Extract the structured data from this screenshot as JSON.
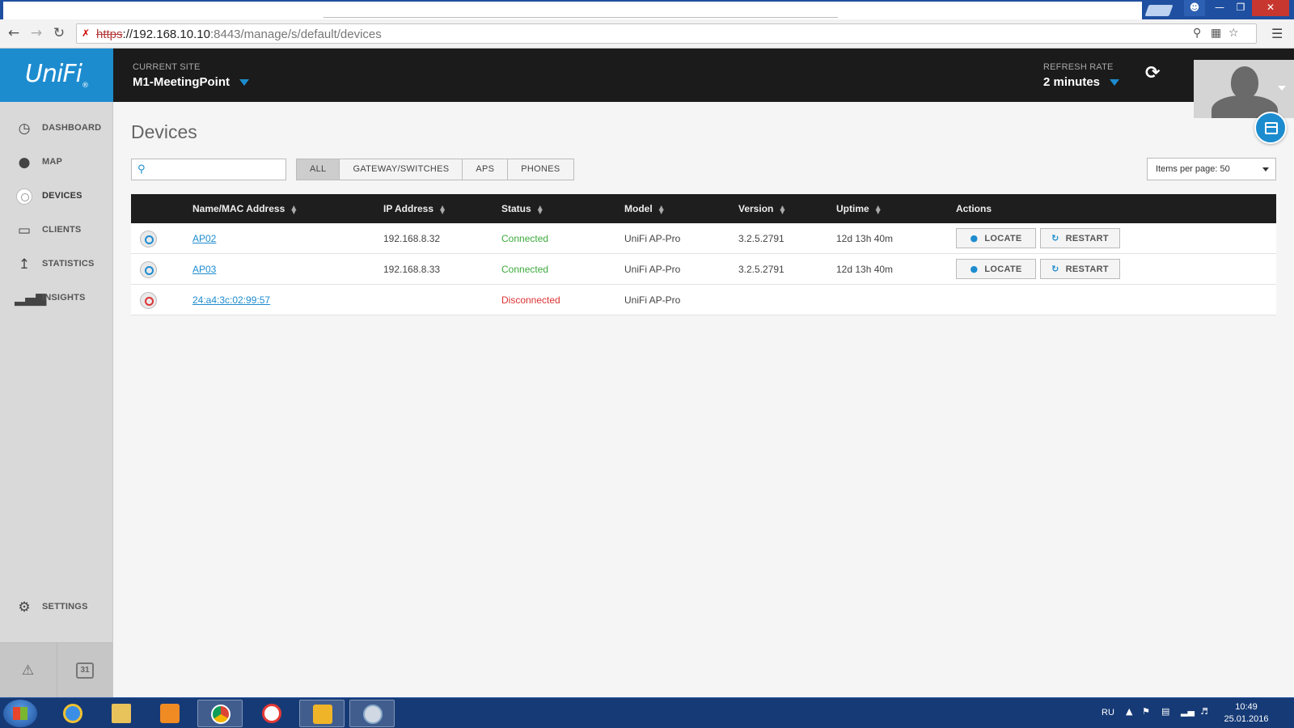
{
  "browser": {
    "url_protocol": "https",
    "url_host": "://192.168.10.10",
    "url_rest": ":8443/manage/s/default/devices"
  },
  "sidebar": {
    "logo": "UniFi",
    "items": [
      {
        "label": "DASHBOARD",
        "icon": "dashboard-gauge-icon"
      },
      {
        "label": "MAP",
        "icon": "map-pin-icon"
      },
      {
        "label": "DEVICES",
        "icon": "devices-icon"
      },
      {
        "label": "CLIENTS",
        "icon": "laptop-icon"
      },
      {
        "label": "STATISTICS",
        "icon": "line-chart-icon"
      },
      {
        "label": "INSIGHTS",
        "icon": "bar-chart-icon"
      }
    ],
    "settings": "SETTINGS",
    "calendar_day": "31"
  },
  "header": {
    "site_caption": "CURRENT SITE",
    "site_name": "M1-MeetingPoint",
    "rate_caption": "REFRESH RATE",
    "rate_value": "2 minutes"
  },
  "main": {
    "title": "Devices",
    "search_placeholder": "",
    "filters": [
      "ALL",
      "GATEWAY/SWITCHES",
      "APS",
      "PHONES"
    ],
    "selected_filter": "ALL",
    "per_page": "Items per page: 50"
  },
  "table": {
    "columns": [
      "Name/MAC Address",
      "IP Address",
      "Status",
      "Model",
      "Version",
      "Uptime",
      "Actions"
    ],
    "locate_label": "LOCATE",
    "restart_label": "RESTART",
    "rows": [
      {
        "name": "AP02",
        "ip": "192.168.8.32",
        "status": "Connected",
        "model": "UniFi AP-Pro",
        "version": "3.2.5.2791",
        "uptime": "12d 13h 40m"
      },
      {
        "name": "AP03",
        "ip": "192.168.8.33",
        "status": "Connected",
        "model": "UniFi AP-Pro",
        "version": "3.2.5.2791",
        "uptime": "12d 13h 40m"
      },
      {
        "name": "24:a4:3c:02:99:57",
        "ip": "",
        "status": "Disconnected",
        "model": "UniFi AP-Pro",
        "version": "",
        "uptime": ""
      }
    ]
  },
  "taskbar": {
    "lang": "RU",
    "time": "10:49",
    "date": "25.01.2016"
  },
  "colors": {
    "accent": "#1d8ccf",
    "connected": "#3caa3c",
    "disconnected": "#dd3333",
    "header_bg": "#1b1b1b"
  }
}
